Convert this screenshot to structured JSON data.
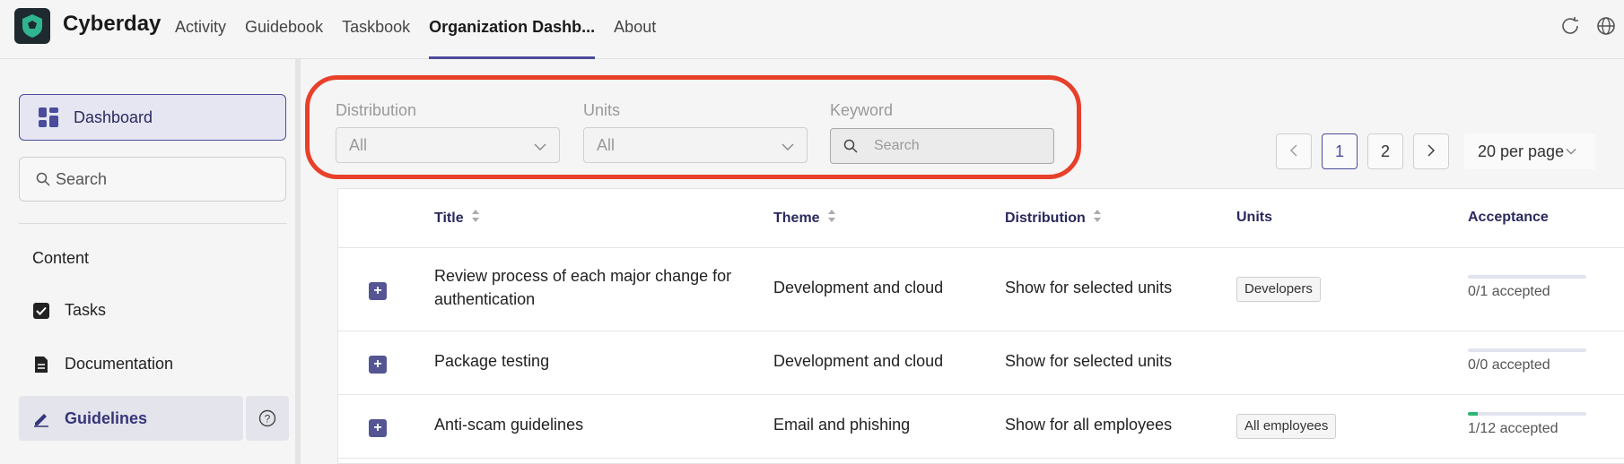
{
  "header": {
    "brand": "Cyberday",
    "nav": [
      "Activity",
      "Guidebook",
      "Taskbook",
      "Organization Dashb...",
      "About"
    ],
    "active_nav": "Organization Dashb..."
  },
  "sidebar": {
    "dashboard_label": "Dashboard",
    "search_placeholder": "Search",
    "content_heading": "Content",
    "items": [
      {
        "label": "Tasks",
        "icon": "checkbox-icon"
      },
      {
        "label": "Documentation",
        "icon": "document-icon"
      },
      {
        "label": "Guidelines",
        "icon": "pen-icon"
      }
    ]
  },
  "filters": {
    "distribution": {
      "label": "Distribution",
      "value": "All"
    },
    "units": {
      "label": "Units",
      "value": "All"
    },
    "keyword": {
      "label": "Keyword",
      "placeholder": "Search"
    }
  },
  "pagination": {
    "pages": [
      "1",
      "2"
    ],
    "current_page": "1",
    "prev": "<",
    "next": ">",
    "per_page": "20 per page"
  },
  "table": {
    "headers": {
      "title": "Title",
      "theme": "Theme",
      "distribution": "Distribution",
      "units": "Units",
      "acceptance": "Acceptance"
    },
    "rows": [
      {
        "title": "Review process of each major change for authentication",
        "theme": "Development and cloud",
        "distribution": "Show for selected units",
        "unit": "Developers",
        "acceptance": "0/1 accepted",
        "accepted_fraction": 0.0
      },
      {
        "title": "Package testing",
        "theme": "Development and cloud",
        "distribution": "Show for selected units",
        "unit": "",
        "acceptance": "0/0 accepted",
        "accepted_fraction": 0.0
      },
      {
        "title": "Anti-scam guidelines",
        "theme": "Email and phishing",
        "distribution": "Show for all employees",
        "unit": "All employees",
        "acceptance": "1/12 accepted",
        "accepted_fraction": 0.083
      }
    ]
  },
  "colors": {
    "accent": "#4b4c9b",
    "highlight": "#e8402a",
    "progress": "#2bb673"
  }
}
